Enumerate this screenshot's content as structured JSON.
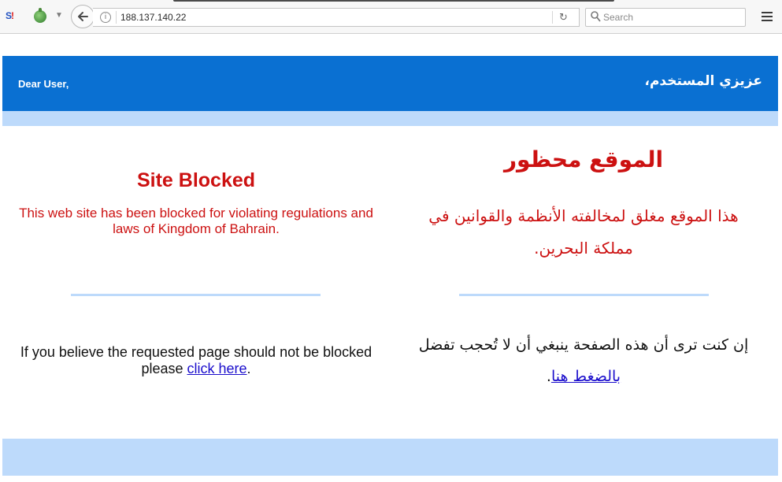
{
  "browser": {
    "url": "188.137.140.22",
    "search_placeholder": "Search",
    "dropdown_glyph": "▼",
    "reload_glyph": "↻",
    "info_glyph": "i",
    "extension_label": {
      "prefix": "S",
      "suffix": "!"
    }
  },
  "page": {
    "greeting_en": "Dear User,",
    "greeting_ar": "عزيزي المستخدم،",
    "title_en": "Site Blocked",
    "message_en": "This web site has been blocked for violating regulations and laws of Kingdom of Bahrain.",
    "title_ar": "الموقع محظور",
    "message_ar": "هذا الموقع مغلق لمخالفته الأنظمة والقوانين في مملكة البحرين.",
    "unblock_en_prefix": "If you believe the requested page should not be blocked please ",
    "unblock_en_link": "click here",
    "unblock_en_suffix": ".",
    "unblock_ar_prefix": "إن كنت ترى أن هذه الصفحة ينبغي أن لا تُحجب تفضل ",
    "unblock_ar_link": "بالضغط هنا",
    "unblock_ar_suffix": "."
  },
  "colors": {
    "header_blue": "#0a70d2",
    "light_blue": "#bddafb",
    "alert_red": "#cc1111",
    "link_blue": "#1a0dcc"
  }
}
